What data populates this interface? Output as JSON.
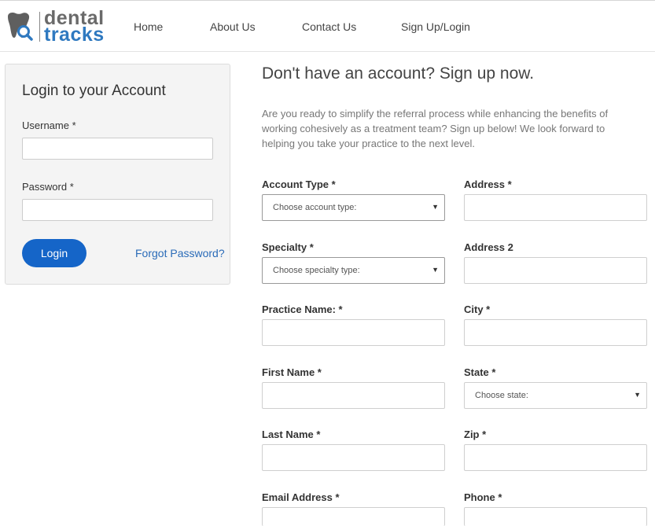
{
  "header": {
    "logo_word1": "dental",
    "logo_word2": "tracks",
    "nav": [
      "Home",
      "About Us",
      "Contact Us",
      "Sign Up/Login"
    ]
  },
  "login": {
    "title": "Login to your Account",
    "username_label": "Username *",
    "password_label": "Password *",
    "login_button": "Login",
    "forgot_link": "Forgot Password?"
  },
  "signup": {
    "title": "Don't have an account? Sign up now.",
    "intro": "Are you ready to simplify the referral process while enhancing the benefits of working cohesively as a treatment team? Sign up below! We look forward to helping you take your practice to the next level.",
    "left_fields": {
      "account_type": {
        "label": "Account Type *",
        "value": "Choose account type:"
      },
      "specialty": {
        "label": "Specialty *",
        "value": "Choose specialty type:"
      },
      "practice_name": {
        "label": "Practice Name: *"
      },
      "first_name": {
        "label": "First Name *"
      },
      "last_name": {
        "label": "Last Name *"
      },
      "email": {
        "label": "Email Address *"
      }
    },
    "right_fields": {
      "address": {
        "label": "Address *"
      },
      "address2": {
        "label": "Address 2"
      },
      "city": {
        "label": "City *"
      },
      "state": {
        "label": "State *",
        "value": "Choose state:"
      },
      "zip": {
        "label": "Zip *"
      },
      "phone": {
        "label": "Phone *"
      }
    },
    "caret": "▼"
  },
  "colors": {
    "brand_blue": "#2f79c0",
    "button_blue": "#1565c8",
    "link_blue": "#2a6bb8"
  }
}
